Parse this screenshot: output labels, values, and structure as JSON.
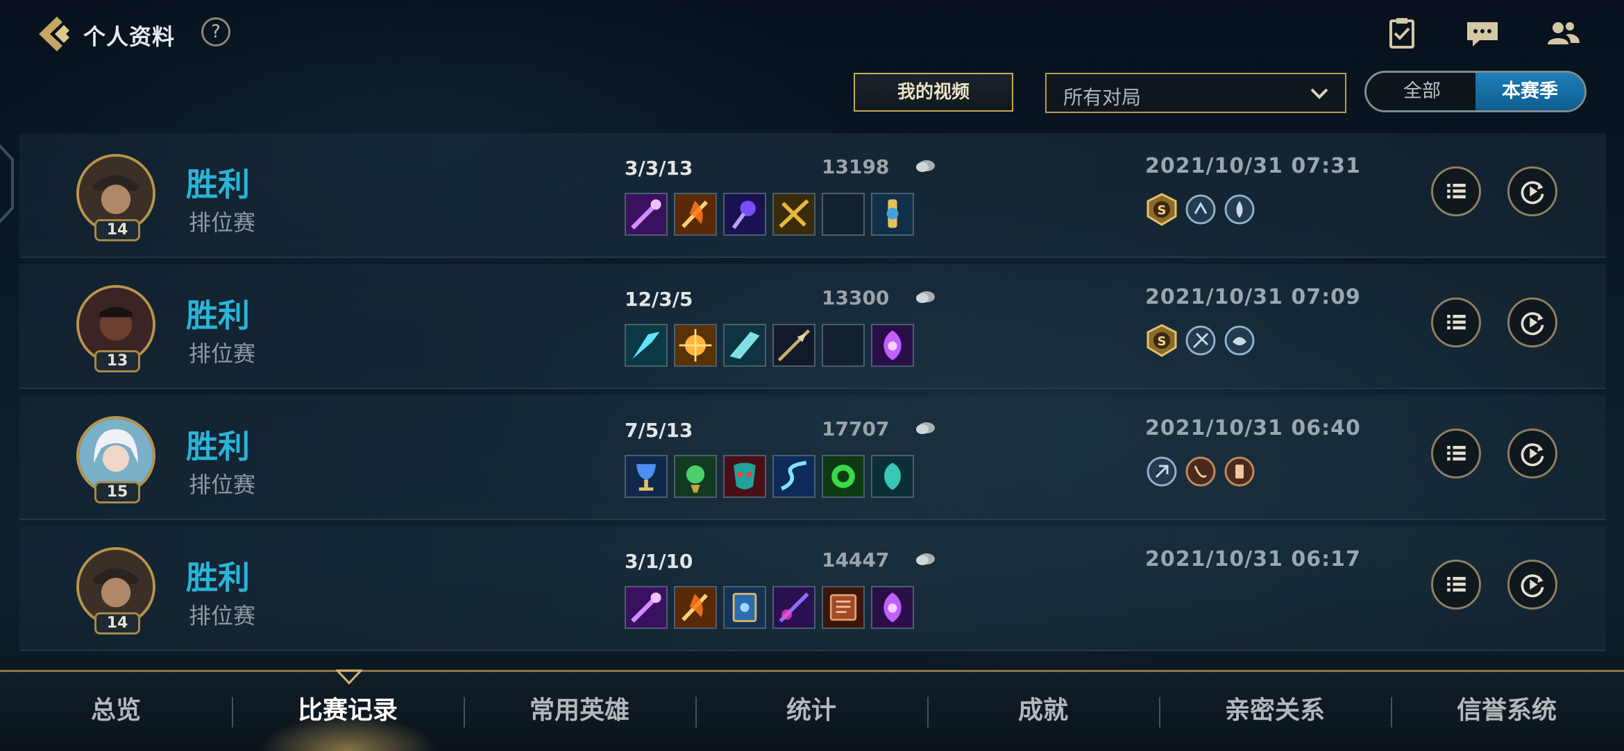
{
  "header": {
    "title": "个人资料",
    "help_label": "?"
  },
  "filters": {
    "my_videos": "我的视频",
    "match_filter": "所有对局",
    "toggle_all": "全部",
    "toggle_season": "本赛季"
  },
  "matches": [
    {
      "level": "14",
      "result": "胜利",
      "mode": "排位赛",
      "kda": "3/3/13",
      "gold": "13198",
      "date": "2021/10/31 07:31",
      "champion_icon": "gunslinger-portrait",
      "items": [
        "purple-staff-icon",
        "flame-sword-icon",
        "void-scepter-icon",
        "gold-blade-icon",
        "empty-slot",
        "ward-trinket-icon"
      ],
      "badges": [
        "s-rank-badge",
        "mvp-badge",
        "streak-badge"
      ]
    },
    {
      "level": "13",
      "result": "胜利",
      "mode": "排位赛",
      "kda": "12/3/5",
      "gold": "13300",
      "date": "2021/10/31 07:09",
      "champion_icon": "marksman-portrait",
      "items": [
        "frost-claw-icon",
        "sun-blade-icon",
        "crystal-wing-icon",
        "dark-lance-icon",
        "empty-slot",
        "violet-ward-icon"
      ],
      "badges": [
        "s-rank-badge",
        "damage-badge",
        "tank-badge"
      ]
    },
    {
      "level": "15",
      "result": "胜利",
      "mode": "排位赛",
      "kda": "7/5/13",
      "gold": "17707",
      "date": "2021/10/31 06:40",
      "champion_icon": "silver-hair-portrait",
      "items": [
        "chalice-icon",
        "jade-totem-icon",
        "demon-mask-icon",
        "storm-blade-icon",
        "green-orb-icon",
        "teal-ward-icon"
      ],
      "badges": [
        "support-badge",
        "shield-badge",
        "gold-badge"
      ]
    },
    {
      "level": "14",
      "result": "胜利",
      "mode": "排位赛",
      "kda": "3/1/10",
      "gold": "14447",
      "date": "2021/10/31 06:17",
      "champion_icon": "gunslinger-portrait",
      "items": [
        "purple-staff-icon",
        "flame-sword-icon",
        "arcane-tome-icon",
        "shadow-blade-icon",
        "leather-tome-icon",
        "violet-ward-icon"
      ],
      "badges": []
    }
  ],
  "tabs": [
    "总览",
    "比赛记录",
    "常用英雄",
    "统计",
    "成就",
    "亲密关系",
    "信誉系统"
  ],
  "active_tab": "比赛记录",
  "colors": {
    "win": "#2ab4d7",
    "accent_gold": "#c8a85a",
    "toggle_active": "#1d7fb6"
  }
}
